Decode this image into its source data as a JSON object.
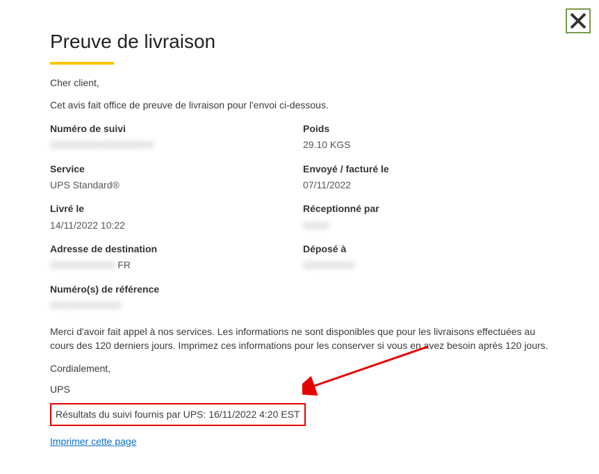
{
  "heading": "Preuve de livraison",
  "greeting": "Cher client,",
  "intro": "Cet avis fait office de preuve de livraison pour l'envoi ci-dessous.",
  "fields": {
    "tracking": {
      "label": "Numéro de suivi",
      "value": "XXXXXXXXXXXXXXXX"
    },
    "weight": {
      "label": "Poids",
      "value": "29.10 KGS"
    },
    "service": {
      "label": "Service",
      "value": "UPS Standard®"
    },
    "billed": {
      "label": "Envoyé / facturé le",
      "value": "07/11/2022"
    },
    "delivered": {
      "label": "Livré le",
      "value": "14/11/2022 10:22"
    },
    "received_by": {
      "label": "Réceptionné par",
      "value": "XXXX"
    },
    "dest_addr": {
      "label": "Adresse de destination",
      "value_prefix": "XXXXXXXXXX",
      "value_suffix": " FR"
    },
    "left_at": {
      "label": "Déposé à",
      "value": "XXXXXXXX"
    },
    "ref": {
      "label": "Numéro(s) de référence",
      "value": "XXXXXXXXXXX"
    }
  },
  "thanks": "Merci d'avoir fait appel à nos services. Les informations ne sont disponibles que pour les livraisons effectuées au cours des 120 derniers jours. Imprimez ces informations pour les conserver si vous en avez besoin après 120 jours.",
  "signoff": "Cordialement,",
  "company": "UPS",
  "results": "Résultats du suivi fournis par UPS: 16/11/2022 4:20 EST",
  "print_label": "Imprimer cette page"
}
